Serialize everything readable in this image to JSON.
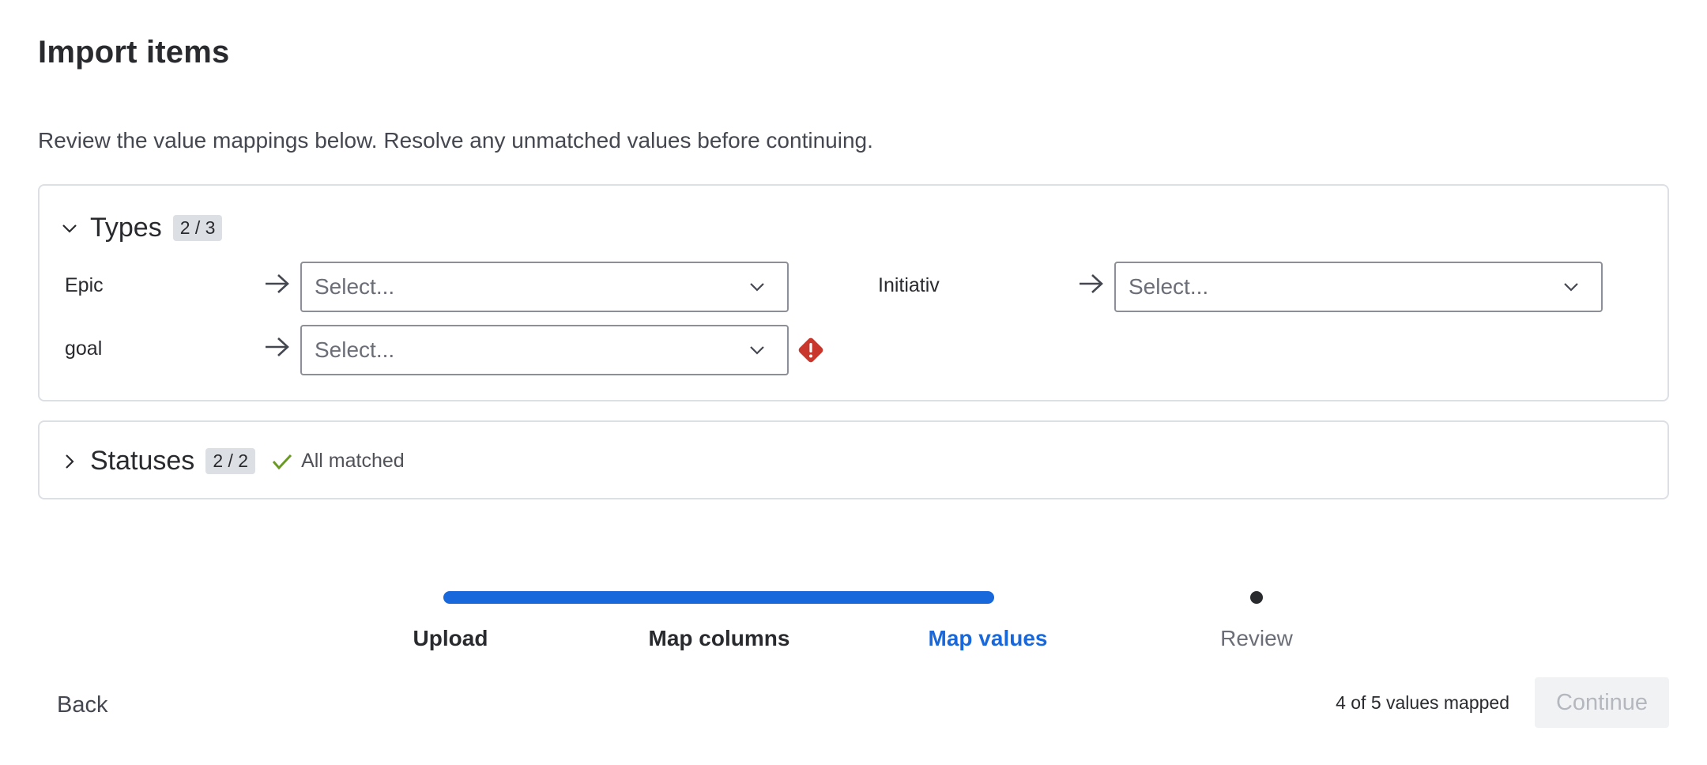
{
  "dialog": {
    "title": "Import items",
    "description": "Review the value mappings below. Resolve any unmatched values before continuing."
  },
  "types_section": {
    "title": "Types",
    "badge": "2 / 3",
    "expanded": true,
    "mappings": [
      {
        "source": "Epic",
        "placeholder": "Select...",
        "error": false
      },
      {
        "source": "Initiativ",
        "placeholder": "Select...",
        "error": false
      },
      {
        "source": "goal",
        "placeholder": "Select...",
        "error": true
      }
    ]
  },
  "statuses_section": {
    "title": "Statuses",
    "badge": "2 / 2",
    "expanded": false,
    "matched_label": "All matched"
  },
  "progress": {
    "steps": [
      "Upload",
      "Map columns",
      "Map values",
      "Review"
    ],
    "current_step": "Map values",
    "progress_fraction": 0.67
  },
  "footer": {
    "back_label": "Back",
    "mapped_status": "4 of 5 values mapped",
    "continue_label": "Continue"
  },
  "colors": {
    "accent": "#1868db",
    "error": "#c9372c",
    "success": "#6a9a23",
    "border": "#dcdfe4"
  },
  "icons": {
    "expand": "chevron-down-icon",
    "collapsed": "chevron-right-icon",
    "arrow": "arrow-right-icon",
    "dropdown": "chevron-down-icon",
    "error": "error-diamond-icon",
    "matched": "checkmark-icon"
  }
}
